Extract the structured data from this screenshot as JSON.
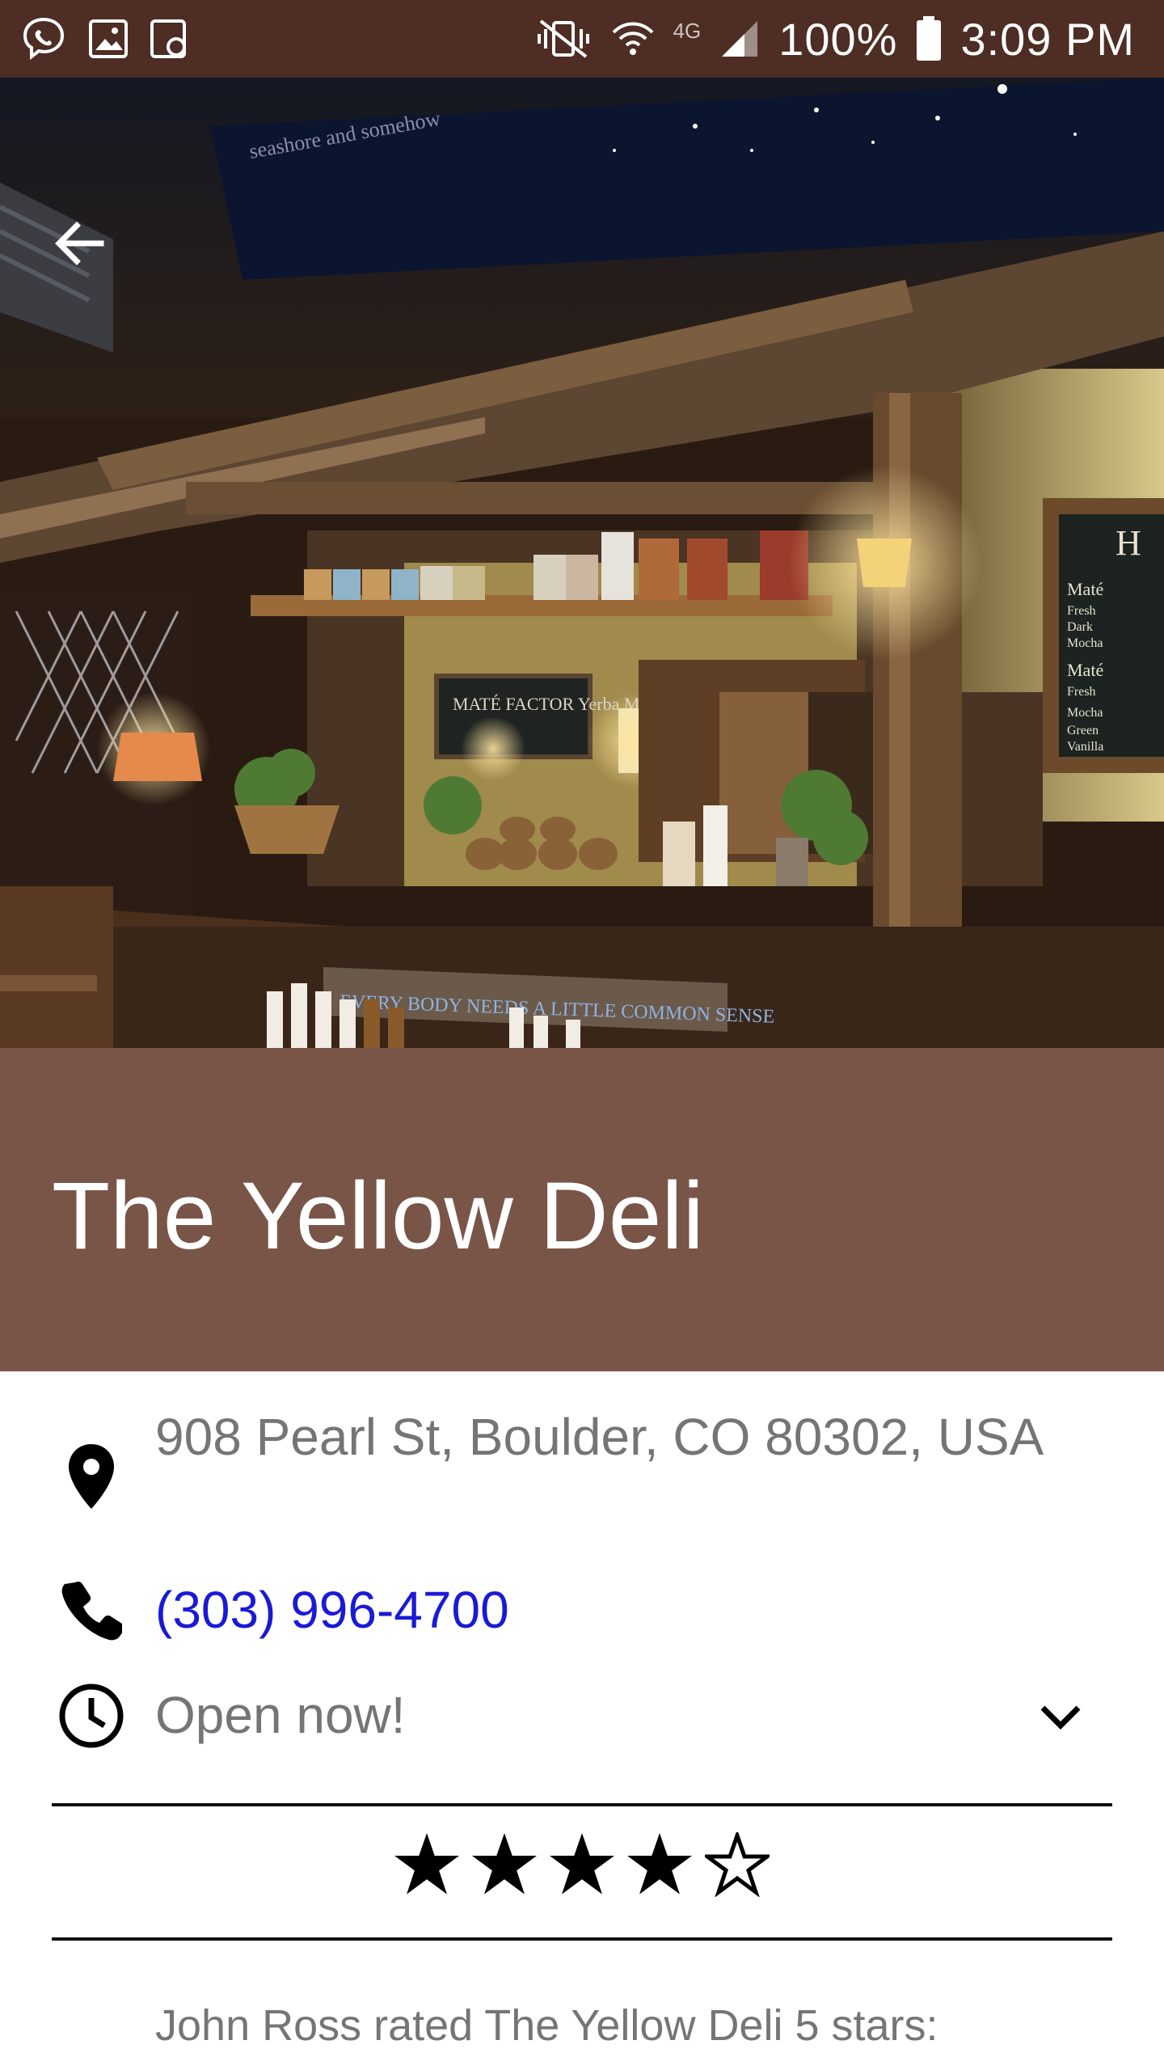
{
  "status_bar": {
    "battery": "100%",
    "time": "3:09 PM",
    "network": "4G"
  },
  "place": {
    "name": "The Yellow Deli",
    "address": "908 Pearl St, Boulder, CO 80302, USA",
    "phone": "(303) 996-4700",
    "hours_status": "Open now!",
    "rating": 4,
    "rating_max": 5,
    "review_snippet": "John Ross rated The Yellow Deli 5 stars:"
  },
  "hero_image": {
    "chalkboard_sign": "MATÉ FACTOR Yerba Maté",
    "counter_sign": "EVERY BODY NEEDS A LITTLE COMMON SENSE"
  },
  "icons": {
    "back": "arrow-left-icon",
    "location": "location-pin-icon",
    "phone": "phone-icon",
    "clock": "clock-icon",
    "expand": "chevron-down-icon",
    "star": "star-icon"
  },
  "colors": {
    "status_bar": "#4e2d24",
    "title_band": "#795548",
    "phone_link": "#1a1ad6",
    "secondary_text": "#757575"
  }
}
